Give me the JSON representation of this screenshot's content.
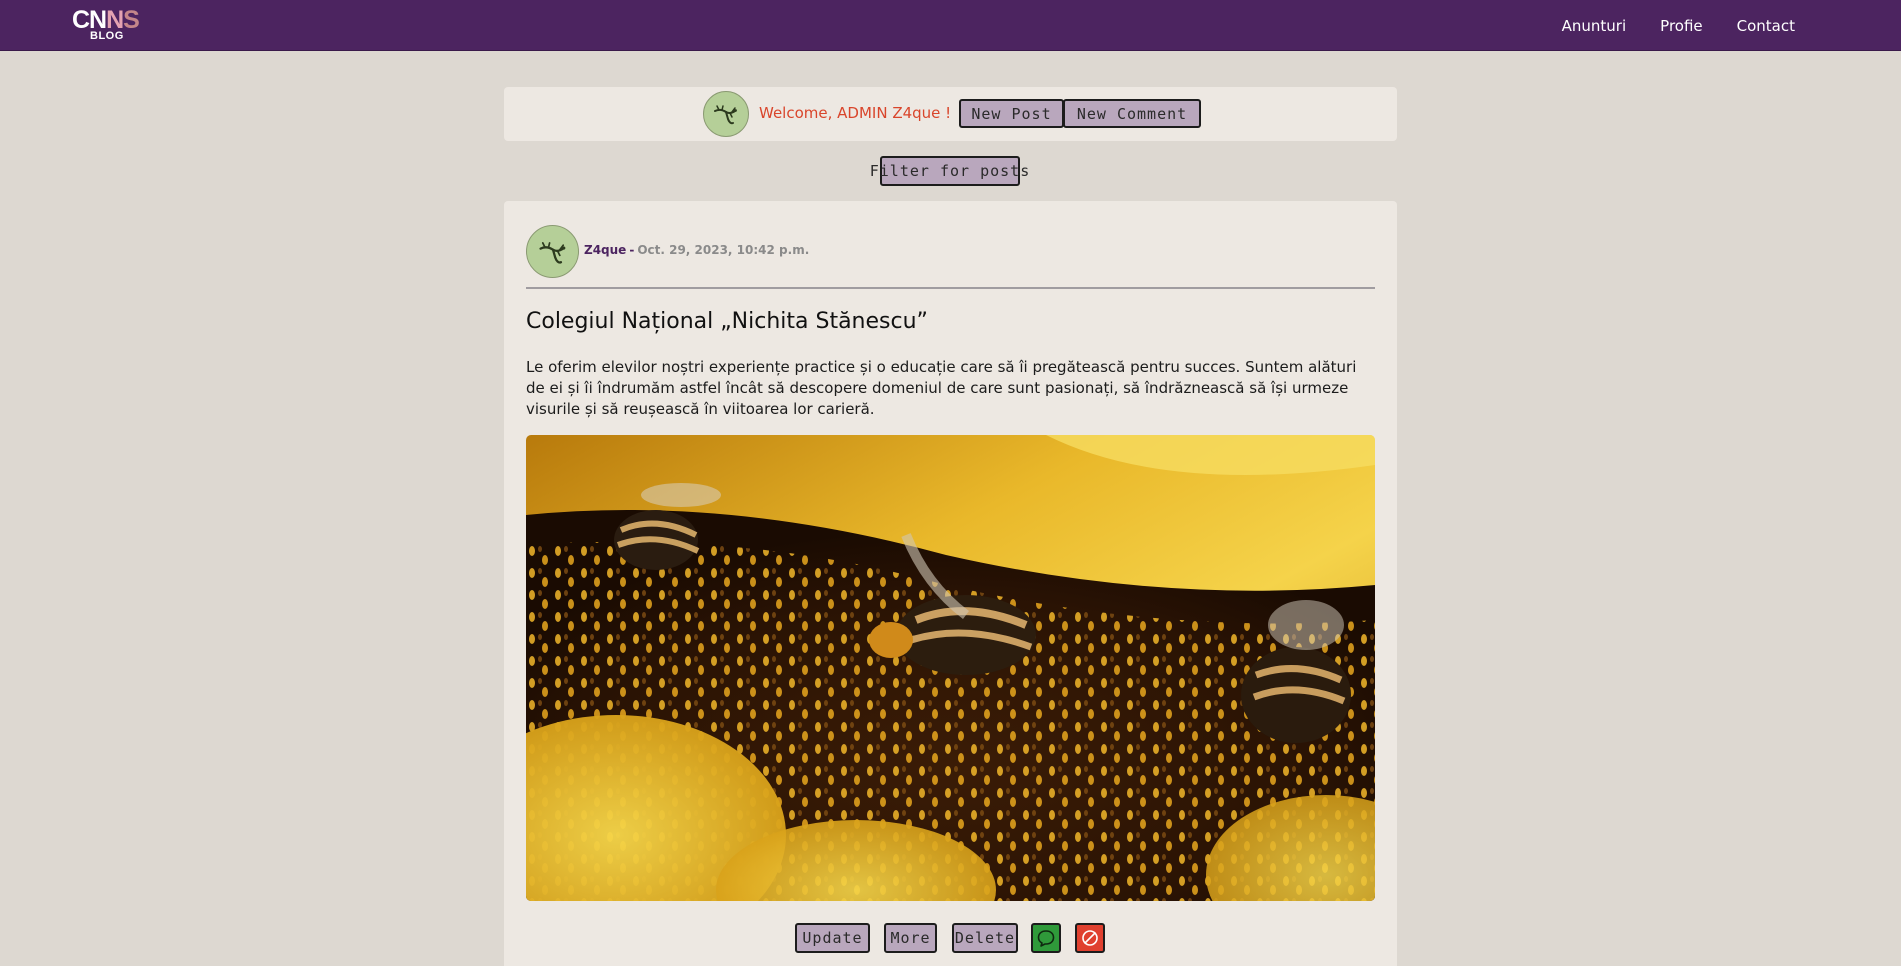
{
  "navbar": {
    "logo": {
      "top_parts": [
        "CN",
        "N",
        "S"
      ],
      "bottom": "BLOG"
    },
    "links": [
      "Anunturi",
      "Profie",
      "Contact"
    ],
    "background_color": "#4c2460"
  },
  "welcome": {
    "text": "Welcome, ADMIN Z4que !",
    "new_post_label": "New Post",
    "new_comment_label": "New Comment",
    "text_color": "#d9452b"
  },
  "filter": {
    "label": "Filter for posts"
  },
  "post": {
    "author": "Z4que",
    "separator": "-",
    "date": "Oct. 29, 2023, 10:42 p.m.",
    "title": "Colegiul Național „Nichita Stănescu”",
    "body": "Le oferim elevilor noștri experiențe practice și o educație care să îi pregătească pentru succes. Suntem alături de ei și îi îndrumăm astfel încât să descopere domeniul de care sunt pasionați, să îndrăznească să își urmeze visurile și să reușească în viitoarea lor carieră.",
    "image_icon": "bees-on-sunflower-photo",
    "actions": {
      "update_label": "Update",
      "more_label": "More",
      "delete_label": "Delete",
      "comment_icon": "comment-bubble-icon",
      "ban_icon": "ban-icon"
    }
  },
  "colors": {
    "page_bg": "#ddd8d1",
    "card_bg": "#ede8e2",
    "button_bg": "#b9a7bd",
    "comment_green": "#2f9a3a",
    "ban_red": "#e0402f",
    "avatar_bg": "#b5cf98"
  }
}
